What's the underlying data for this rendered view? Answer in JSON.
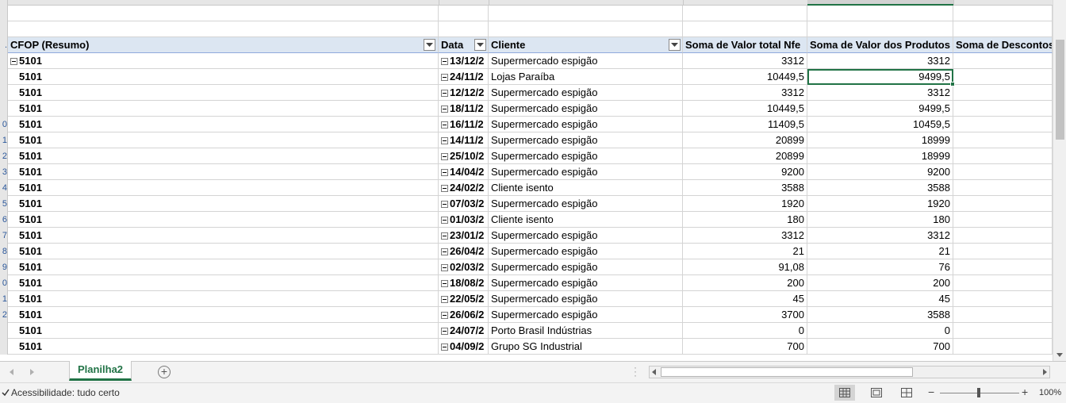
{
  "columns": {
    "cfop": "CFOP (Resumo)",
    "data": "Data",
    "cliente": "Cliente",
    "valor_total": "Soma de Valor total Nfe",
    "valor_produtos": "Soma de Valor dos Produtos",
    "descontos": "Soma de Descontos"
  },
  "row_numbers": [
    "",
    "",
    "",
    ".",
    "",
    "",
    "",
    "",
    "0",
    "1",
    "2",
    "3",
    "4",
    "5",
    "6",
    "7",
    "8",
    "9",
    "0",
    "1",
    "2",
    "",
    ""
  ],
  "rows": [
    {
      "cfop": "5101",
      "data": "13/12/2",
      "cliente": "Supermercado espigão",
      "vt": "3312",
      "vp": "3312"
    },
    {
      "cfop": "5101",
      "data": "24/11/2",
      "cliente": "Lojas Paraíba",
      "vt": "10449,5",
      "vp": "9499,5"
    },
    {
      "cfop": "5101",
      "data": "12/12/2",
      "cliente": "Supermercado espigão",
      "vt": "3312",
      "vp": "3312"
    },
    {
      "cfop": "5101",
      "data": "18/11/2",
      "cliente": "Supermercado espigão",
      "vt": "10449,5",
      "vp": "9499,5"
    },
    {
      "cfop": "5101",
      "data": "16/11/2",
      "cliente": "Supermercado espigão",
      "vt": "11409,5",
      "vp": "10459,5"
    },
    {
      "cfop": "5101",
      "data": "14/11/2",
      "cliente": "Supermercado espigão",
      "vt": "20899",
      "vp": "18999"
    },
    {
      "cfop": "5101",
      "data": "25/10/2",
      "cliente": "Supermercado espigão",
      "vt": "20899",
      "vp": "18999"
    },
    {
      "cfop": "5101",
      "data": "14/04/2",
      "cliente": "Supermercado espigão",
      "vt": "9200",
      "vp": "9200"
    },
    {
      "cfop": "5101",
      "data": "24/02/2",
      "cliente": "Cliente isento",
      "vt": "3588",
      "vp": "3588"
    },
    {
      "cfop": "5101",
      "data": "07/03/2",
      "cliente": "Supermercado espigão",
      "vt": "1920",
      "vp": "1920"
    },
    {
      "cfop": "5101",
      "data": "01/03/2",
      "cliente": "Cliente isento",
      "vt": "180",
      "vp": "180"
    },
    {
      "cfop": "5101",
      "data": "23/01/2",
      "cliente": "Supermercado espigão",
      "vt": "3312",
      "vp": "3312"
    },
    {
      "cfop": "5101",
      "data": "26/04/2",
      "cliente": "Supermercado espigão",
      "vt": "21",
      "vp": "21"
    },
    {
      "cfop": "5101",
      "data": "02/03/2",
      "cliente": "Supermercado espigão",
      "vt": "91,08",
      "vp": "76"
    },
    {
      "cfop": "5101",
      "data": "18/08/2",
      "cliente": "Supermercado espigão",
      "vt": "200",
      "vp": "200"
    },
    {
      "cfop": "5101",
      "data": "22/05/2",
      "cliente": "Supermercado espigão",
      "vt": "45",
      "vp": "45"
    },
    {
      "cfop": "5101",
      "data": "26/06/2",
      "cliente": "Supermercado espigão",
      "vt": "3700",
      "vp": "3588"
    },
    {
      "cfop": "5101",
      "data": "24/07/2",
      "cliente": "Porto Brasil Indústrias",
      "vt": "0",
      "vp": "0"
    },
    {
      "cfop": "5101",
      "data": "04/09/2",
      "cliente": "Grupo SG Industrial",
      "vt": "700",
      "vp": "700"
    }
  ],
  "sheet_tab": "Planilha2",
  "status": {
    "accessibility": "Acessibilidade: tudo certo",
    "zoom": "100%",
    "zoom_level": 1.0
  },
  "icons": {
    "filter": "filter-dropdown-icon",
    "collapse": "collapse-minus-icon",
    "add_sheet": "plus-circle-icon",
    "view_normal": "grid-view-icon",
    "view_layout": "page-layout-icon",
    "view_break": "page-break-icon",
    "accessibility": "accessibility-check-icon"
  },
  "colors": {
    "accent": "#217346",
    "header_bg": "#dce6f2"
  }
}
